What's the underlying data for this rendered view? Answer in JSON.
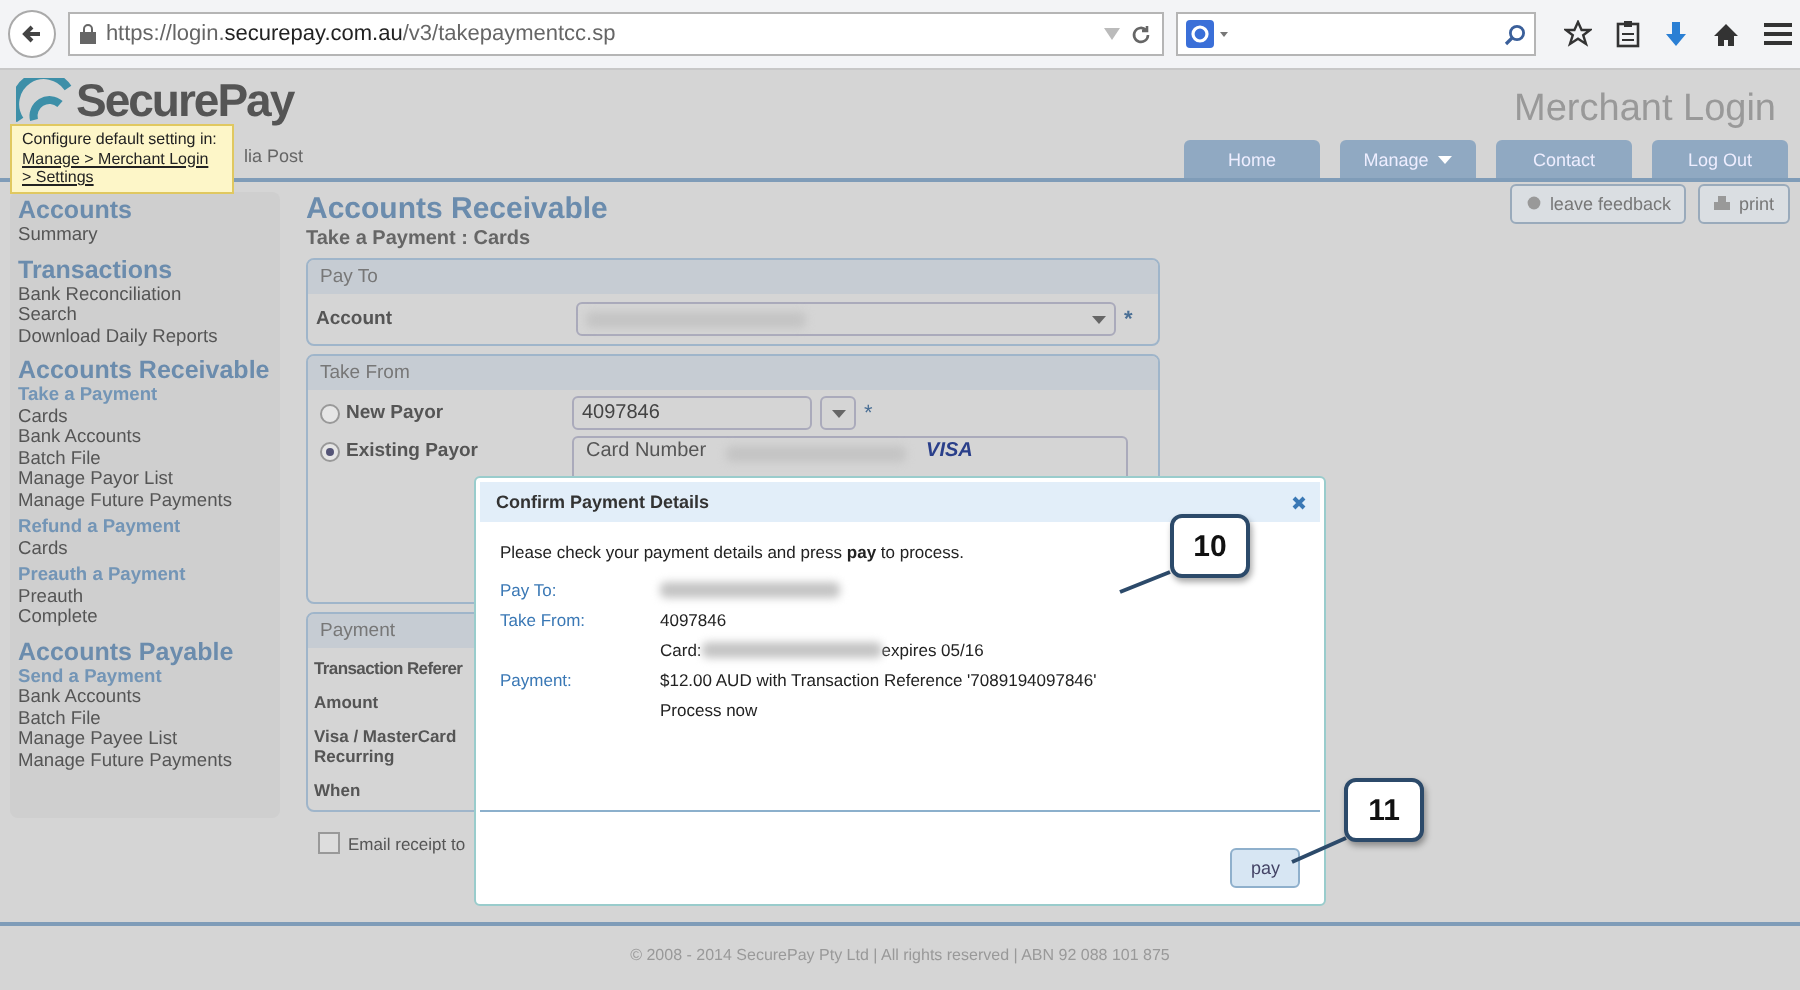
{
  "browser": {
    "url": "https://login.**securepay.com.au**/v3/takepaymentcc.sp"
  },
  "header": {
    "logo": "SecurePay",
    "logo_sub": "lia Post",
    "tooltip_text": "Configure default setting in:",
    "tooltip_link": "Manage > Merchant Login > Settings",
    "title": "Merchant Login",
    "nav": [
      {
        "label": "Home",
        "dropdown": false
      },
      {
        "label": "Manage",
        "dropdown": true
      },
      {
        "label": "Contact",
        "dropdown": false
      },
      {
        "label": "Log Out",
        "dropdown": false
      }
    ]
  },
  "sidebar": [
    {
      "heading": "Accounts",
      "items": [
        {
          "kind": "link",
          "label": "Summary"
        }
      ]
    },
    {
      "heading": "Transactions",
      "items": [
        {
          "kind": "link",
          "label": "Bank Reconciliation"
        },
        {
          "kind": "link",
          "label": "Search"
        },
        {
          "kind": "link",
          "label": "Download Daily Reports"
        }
      ]
    },
    {
      "heading": "Accounts Receivable",
      "items": [
        {
          "kind": "subheading",
          "label": "Take a Payment"
        },
        {
          "kind": "link",
          "label": "Cards"
        },
        {
          "kind": "link",
          "label": "Bank Accounts"
        },
        {
          "kind": "link",
          "label": "Batch File"
        },
        {
          "kind": "link",
          "label": "Manage Payor List"
        },
        {
          "kind": "link",
          "label": "Manage Future Payments"
        },
        {
          "kind": "subheading",
          "label": "Refund a Payment"
        },
        {
          "kind": "link",
          "label": "Cards"
        },
        {
          "kind": "subheading",
          "label": "Preauth a Payment"
        },
        {
          "kind": "link",
          "label": "Preauth"
        },
        {
          "kind": "link",
          "label": "Complete"
        }
      ]
    },
    {
      "heading": "Accounts Payable",
      "items": [
        {
          "kind": "subheading",
          "label": "Send a Payment"
        },
        {
          "kind": "link",
          "label": "Bank Accounts"
        },
        {
          "kind": "link",
          "label": "Batch File"
        },
        {
          "kind": "link",
          "label": "Manage Payee List"
        },
        {
          "kind": "link",
          "label": "Manage Future Payments"
        }
      ]
    }
  ],
  "main": {
    "title": "Accounts Receivable",
    "subtitle": "Take a Payment : Cards",
    "actions": [
      "leave feedback",
      "print"
    ],
    "pay_to": {
      "title": "Pay To",
      "account_label": "Account",
      "required": "*"
    },
    "take_from": {
      "title": "Take From",
      "options": [
        {
          "label": "New Payor",
          "selected": false
        },
        {
          "label": "Existing Payor",
          "selected": true
        }
      ],
      "payor_value": "4097846",
      "required": "*",
      "card_label": "Card Number",
      "card_brand": "VISA"
    },
    "payment": {
      "title": "Payment",
      "labels": [
        "Transaction Referer",
        "Amount",
        "Visa / MasterCard Recurring",
        "When"
      ]
    },
    "email_receipt": {
      "label": "Email receipt to",
      "checked": false
    }
  },
  "dialog": {
    "title": "Confirm Payment Details",
    "intro": "Please check your payment details and press **pay** to process.",
    "rows": [
      {
        "label": "Pay To:",
        "parts": [
          {
            "kind": "redacted"
          }
        ]
      },
      {
        "label": "Take From:",
        "parts": [
          {
            "kind": "text",
            "text": "4097846"
          }
        ]
      },
      {
        "parts": [
          {
            "kind": "text",
            "text": "Card:"
          },
          {
            "kind": "redacted"
          },
          {
            "kind": "text",
            "text": "expires 05/16"
          }
        ]
      },
      {
        "label": "Payment:",
        "parts": [
          {
            "kind": "text",
            "text": "$12.00 AUD with Transaction Reference '7089194097846'"
          }
        ]
      },
      {
        "parts": [
          {
            "kind": "text",
            "text": "Process now"
          }
        ]
      }
    ],
    "button": "pay"
  },
  "callouts": [
    "10",
    "11"
  ],
  "footer": "© 2008 - 2014 SecurePay Pty Ltd | All rights reserved | ABN 92 088 101 875"
}
